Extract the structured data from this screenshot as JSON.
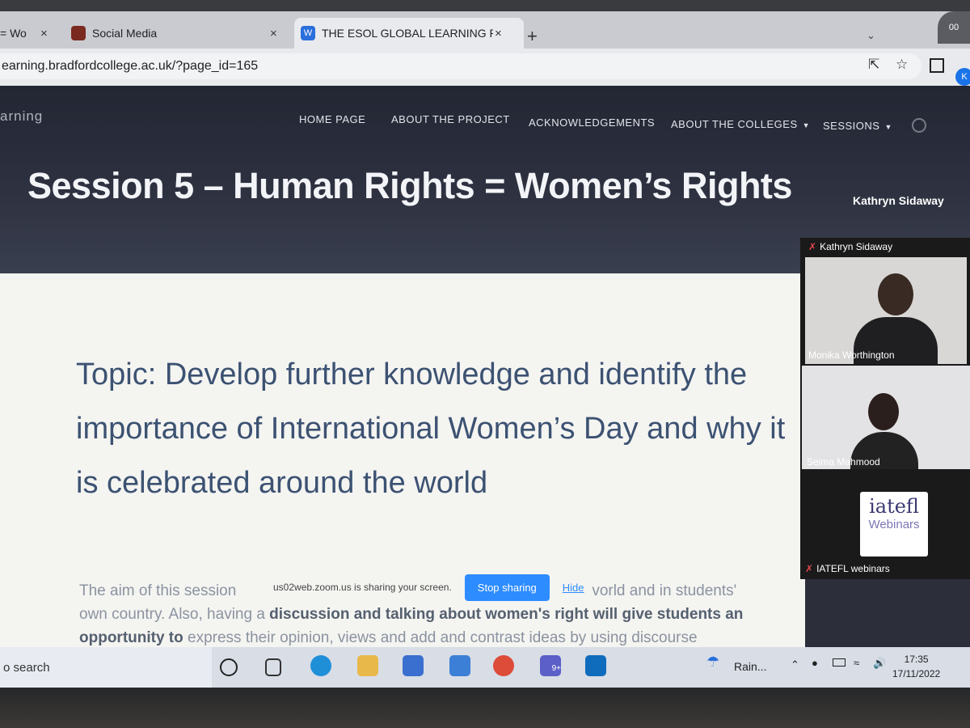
{
  "browser": {
    "tabs": [
      {
        "label": "= Wo",
        "active": false
      },
      {
        "label": "Social Media",
        "active": false
      },
      {
        "label": "THE ESOL GLOBAL LEARNING PR",
        "active": true
      }
    ],
    "new_tab": "+",
    "close_glyph": "×",
    "url": "earning.bradfordcollege.ac.uk/?page_id=165",
    "window_button": "00",
    "profile_initial": "K"
  },
  "site": {
    "brand": "arning",
    "nav": [
      {
        "label": "HOME PAGE"
      },
      {
        "label": "ABOUT THE PROJECT"
      },
      {
        "label": "ACKNOWLEDGEMENTS"
      },
      {
        "label": "ABOUT THE COLLEGES"
      },
      {
        "label": "SESSIONS"
      }
    ],
    "hero_title": "Session 5 – Human Rights = Women’s Rights",
    "topic": "Topic: Develop further knowledge and identify the importance of International Women’s Day and why it is celebrated around the world",
    "body_start": "The aim of this session",
    "body_line1_end": "vorld and in students'",
    "body_line2a": "own country.  Also, having a ",
    "body_line2b": "discussion and talking about women's right",
    "body_line2c": " will give students an",
    "body_line3a": "opportunity to",
    "body_line3b": " express their opinion, views and add and contrast ideas by using discourse"
  },
  "zoom": {
    "active_speaker": "Kathryn Sidaway",
    "share_message": "us02web.zoom.us is sharing your screen.",
    "stop_sharing": "Stop sharing",
    "hide": "Hide",
    "participants": [
      {
        "name": "Kathryn Sidaway",
        "muted": true
      },
      {
        "name": "Monika Worthington",
        "muted": false
      },
      {
        "name": "Seima Mahmood",
        "muted": false
      },
      {
        "name": "IATEFL webinars",
        "muted": true
      }
    ],
    "logo_main": "iatefl",
    "logo_sub": "Webinars"
  },
  "taskbar": {
    "search": "o search",
    "weather": "Rain...",
    "time": "17:35",
    "date": "17/11/2022",
    "teams_badge": "9+"
  },
  "colors": {
    "accent": "#2d8cff",
    "topic_text": "#3c5272",
    "hero_bg": "#2e3241"
  }
}
